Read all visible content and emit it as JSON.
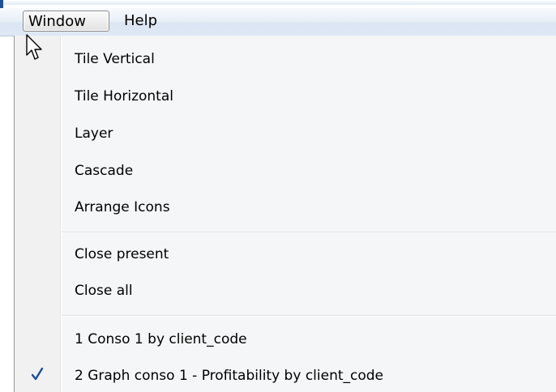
{
  "menubar": {
    "items": [
      {
        "label": "Window"
      },
      {
        "label": "Help"
      }
    ]
  },
  "dropdown": {
    "items": [
      {
        "label": "Tile Vertical"
      },
      {
        "label": "Tile Horizontal"
      },
      {
        "label": "Layer"
      },
      {
        "label": "Cascade"
      },
      {
        "label": "Arrange Icons"
      },
      {
        "label": "Close present"
      },
      {
        "label": "Close all"
      },
      {
        "label": "1 Conso 1 by client_code",
        "checked": false
      },
      {
        "label": "2 Graph conso 1 - Profitability by client_code",
        "checked": true
      }
    ]
  },
  "icons": {
    "check": "check-icon",
    "cursor": "mouse-pointer-icon"
  },
  "colors": {
    "check": "#1a4fa0",
    "menubar_gradient_bottom": "#dfe8f5",
    "menu_background": "#f5f6f7"
  }
}
